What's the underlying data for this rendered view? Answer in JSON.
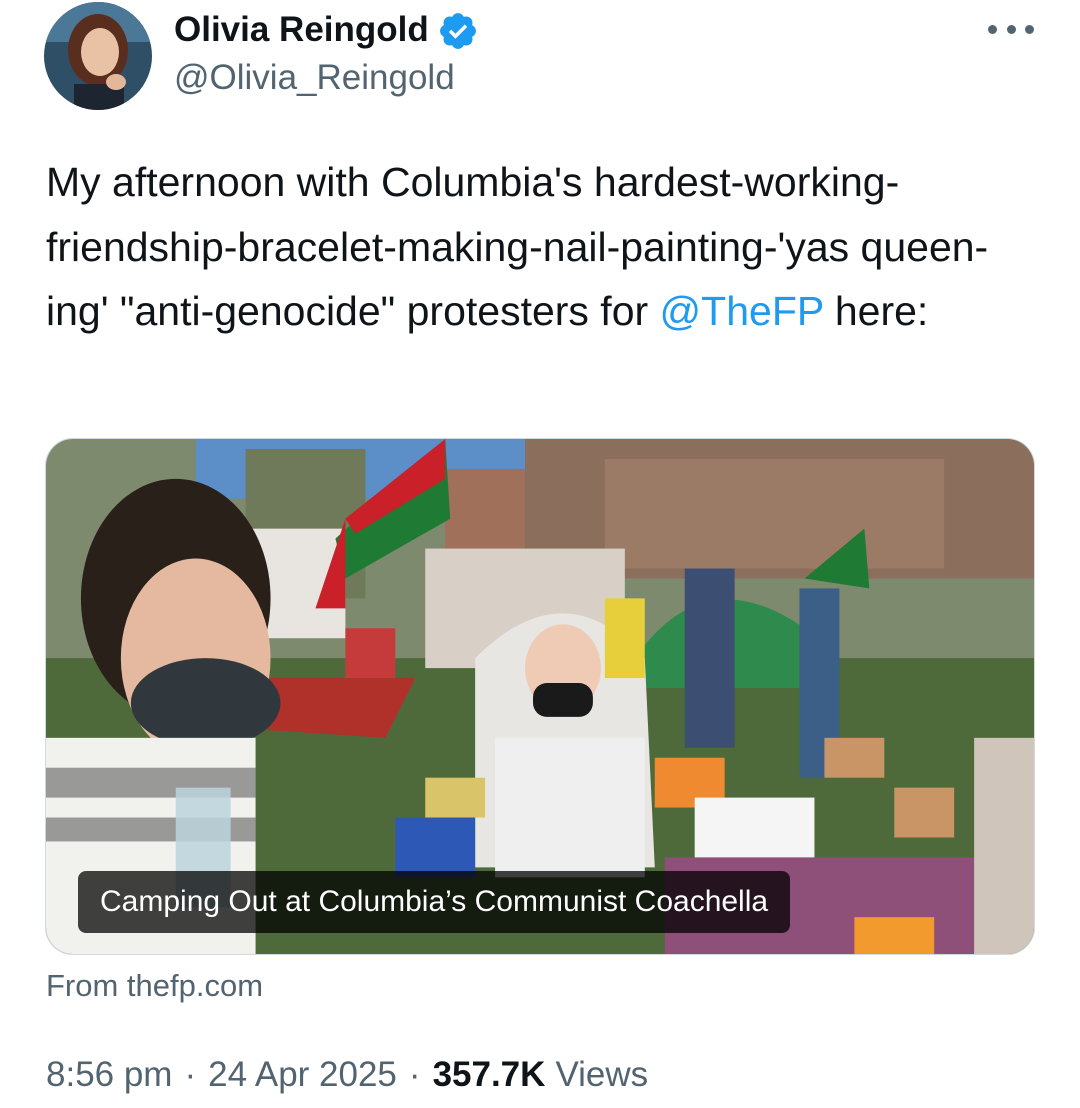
{
  "author": {
    "display_name": "Olivia Reingold",
    "handle": "@Olivia_Reingold",
    "verified": true
  },
  "tweet": {
    "text_before": "My afternoon with Columbia's hardest-working-friendship-bracelet-making-nail-painting-'yas queen-ing' \"anti-genocide\" protesters for ",
    "mention": "@TheFP",
    "text_after": " here:"
  },
  "card": {
    "caption": "Camping Out at Columbia’s Communist Coachella",
    "source": "From thefp.com"
  },
  "meta": {
    "time": "8:56 pm",
    "date": "24 Apr 2025",
    "separator": "·",
    "views_count": "357.7K",
    "views_label": "Views"
  },
  "colors": {
    "accent": "#1d9bf0",
    "secondary_text": "#536471",
    "primary_text": "#0f1419"
  }
}
